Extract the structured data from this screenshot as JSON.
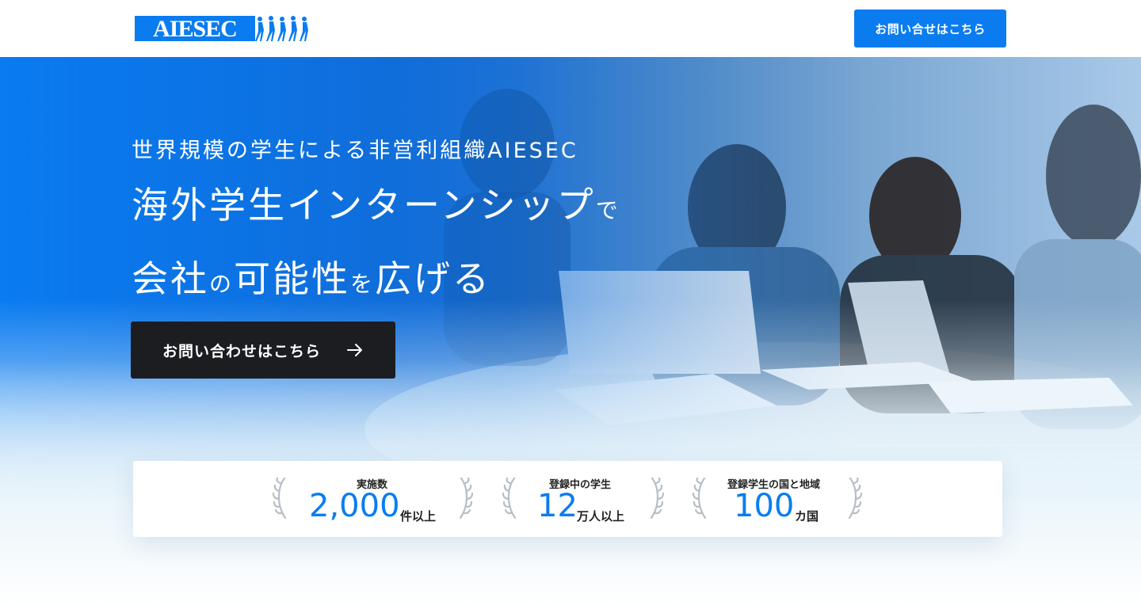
{
  "header": {
    "logo_text": "AIESEC",
    "cta_label": "お問い合せはこちら"
  },
  "hero": {
    "subtitle": "世界規模の学生による非営利組織AIESEC",
    "title_line1_main": "海外学生インターンシップ",
    "title_line1_small": "で",
    "title_line2_a": "会社",
    "title_line2_b": "の",
    "title_line2_c": "可能性",
    "title_line2_d": "を",
    "title_line2_e": "広げる",
    "cta_label": "お問い合わせはこちら"
  },
  "stats": [
    {
      "label": "実施数",
      "value": "2,000",
      "unit": "件以上"
    },
    {
      "label": "登録中の学生",
      "value": "12",
      "unit": "万人以上"
    },
    {
      "label": "登録学生の国と地域",
      "value": "100",
      "unit": "カ国"
    }
  ],
  "colors": {
    "accent": "#0a7cf0",
    "dark_button": "#1c1d21",
    "hero_blue": "#0d62d8"
  },
  "icons": {
    "hero_cta_icon": "arrow-right-icon",
    "stat_decoration": "laurel-icon"
  }
}
